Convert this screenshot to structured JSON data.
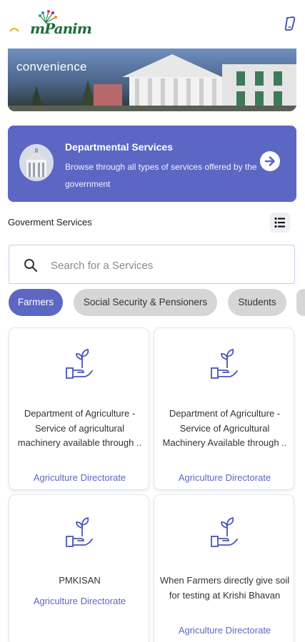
{
  "header": {
    "logo_text": "mPanim",
    "logo_name": "emblem-logo",
    "menu_icon": "phone-icon"
  },
  "hero": {
    "text": "convenience"
  },
  "departmental": {
    "title": "Departmental Services",
    "description": "Browse through all types of services offered by the government",
    "emblem_icon": "building-emblem-icon",
    "arrow_icon": "arrow-right-circle-icon"
  },
  "services": {
    "title": "Goverment Services",
    "list_icon": "list-view-icon"
  },
  "search": {
    "placeholder": "Search for a Services",
    "value": "",
    "icon": "search-icon"
  },
  "categories": [
    {
      "label": "Farmers",
      "active": true
    },
    {
      "label": "Social Security & Pensioners",
      "active": false
    },
    {
      "label": "Students",
      "active": false
    }
  ],
  "cards": [
    {
      "title": "Department of Agriculture - Service of agricultural machinery available through ..",
      "directorate": "Agriculture Directorate",
      "icon": "plant-in-hand-icon"
    },
    {
      "title": "Department of Agriculture - Service of Agricultural Machinery Available through ..",
      "directorate": "Agriculture Directorate",
      "icon": "plant-in-hand-icon"
    },
    {
      "title": "PMKISAN",
      "directorate": "Agriculture Directorate",
      "icon": "plant-in-hand-icon"
    },
    {
      "title": "When Farmers directly give soil for testing at Krishi Bhavan",
      "directorate": "Agriculture Directorate",
      "icon": "plant-in-hand-icon"
    }
  ],
  "colors": {
    "accent": "#5c67c4",
    "chip_inactive": "#d6d6d6",
    "text": "#333333"
  }
}
